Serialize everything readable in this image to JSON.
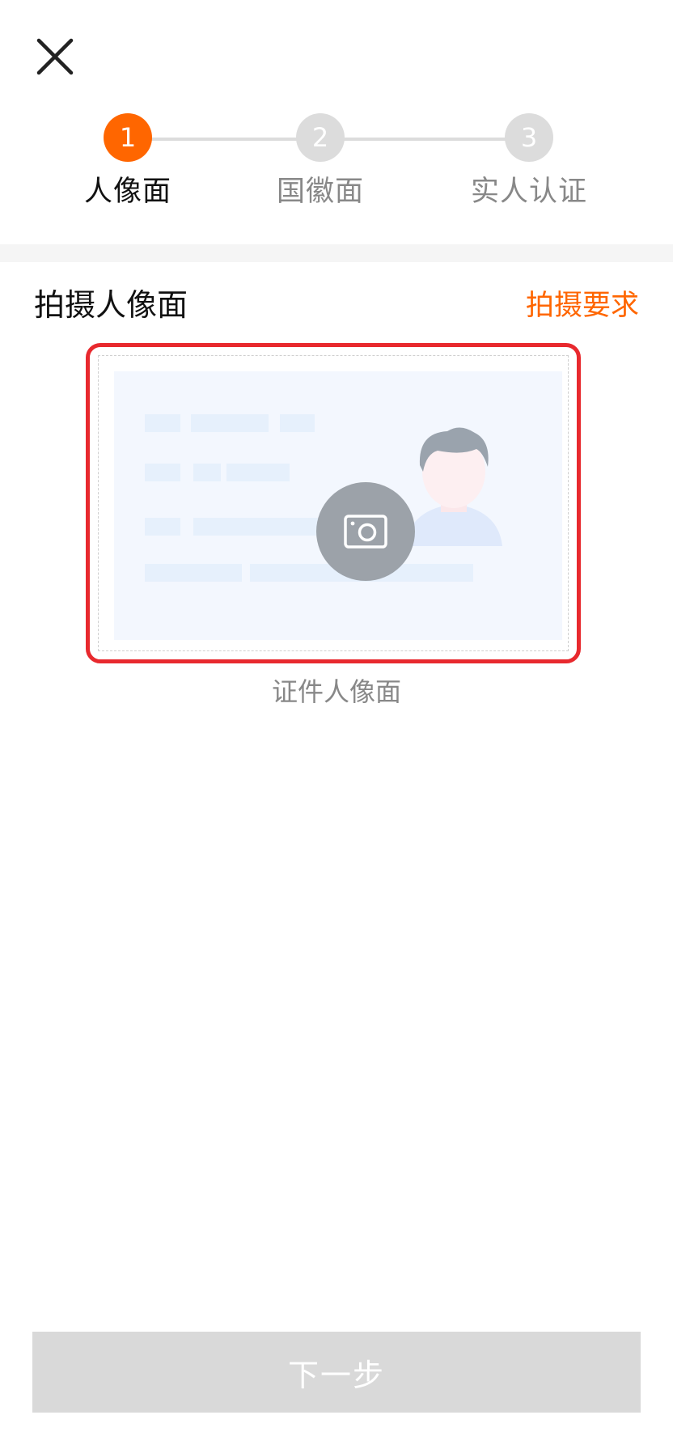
{
  "colors": {
    "accent": "#ff6600",
    "inactive_step": "#dcdcdc",
    "frame_highlight": "#e8292e",
    "disabled_button": "#d9d9d9"
  },
  "header": {
    "close_icon": "close-icon"
  },
  "steps": [
    {
      "number": "1",
      "label": "人像面",
      "state": "active"
    },
    {
      "number": "2",
      "label": "国徽面",
      "state": "inactive"
    },
    {
      "number": "3",
      "label": "实人认证",
      "state": "inactive"
    }
  ],
  "section": {
    "title": "拍摄人像面",
    "requirements_link": "拍摄要求"
  },
  "capture": {
    "camera_icon": "camera-icon",
    "caption": "证件人像面"
  },
  "footer": {
    "next_button": "下一步",
    "next_enabled": false
  }
}
